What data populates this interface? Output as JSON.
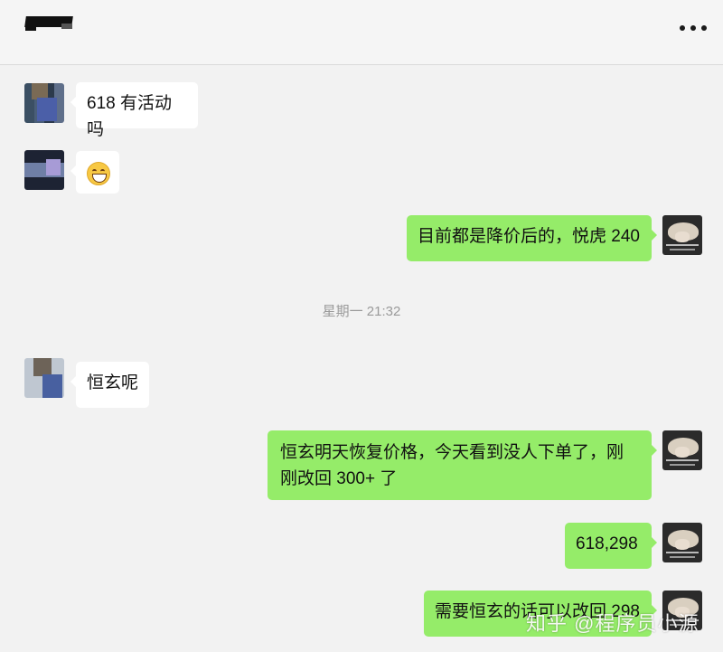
{
  "header": {
    "title": "",
    "more_icon": "more-horizontal-icon"
  },
  "messages": [
    {
      "side": "left",
      "text": "618 有活动吗"
    },
    {
      "side": "left",
      "emoji": "grinning-face-icon"
    },
    {
      "side": "right",
      "text": "目前都是降价后的，悦虎 240"
    },
    {
      "side": "right",
      "text": "恒玄明天恢复价格，今天看到没人下单了，刚刚改回 300+ 了"
    },
    {
      "side": "right",
      "text": "618,298"
    },
    {
      "side": "right",
      "text": "需要恒玄的话可以改回 298"
    },
    {
      "side": "left",
      "text": "恒玄呢"
    }
  ],
  "timestamp": "星期一 21:32",
  "watermark": "知乎 @程序员小源",
  "colors": {
    "background": "#f2f2f2",
    "incoming_bubble": "#ffffff",
    "outgoing_bubble": "#95ec69",
    "timestamp_text": "#9a9a9a"
  }
}
